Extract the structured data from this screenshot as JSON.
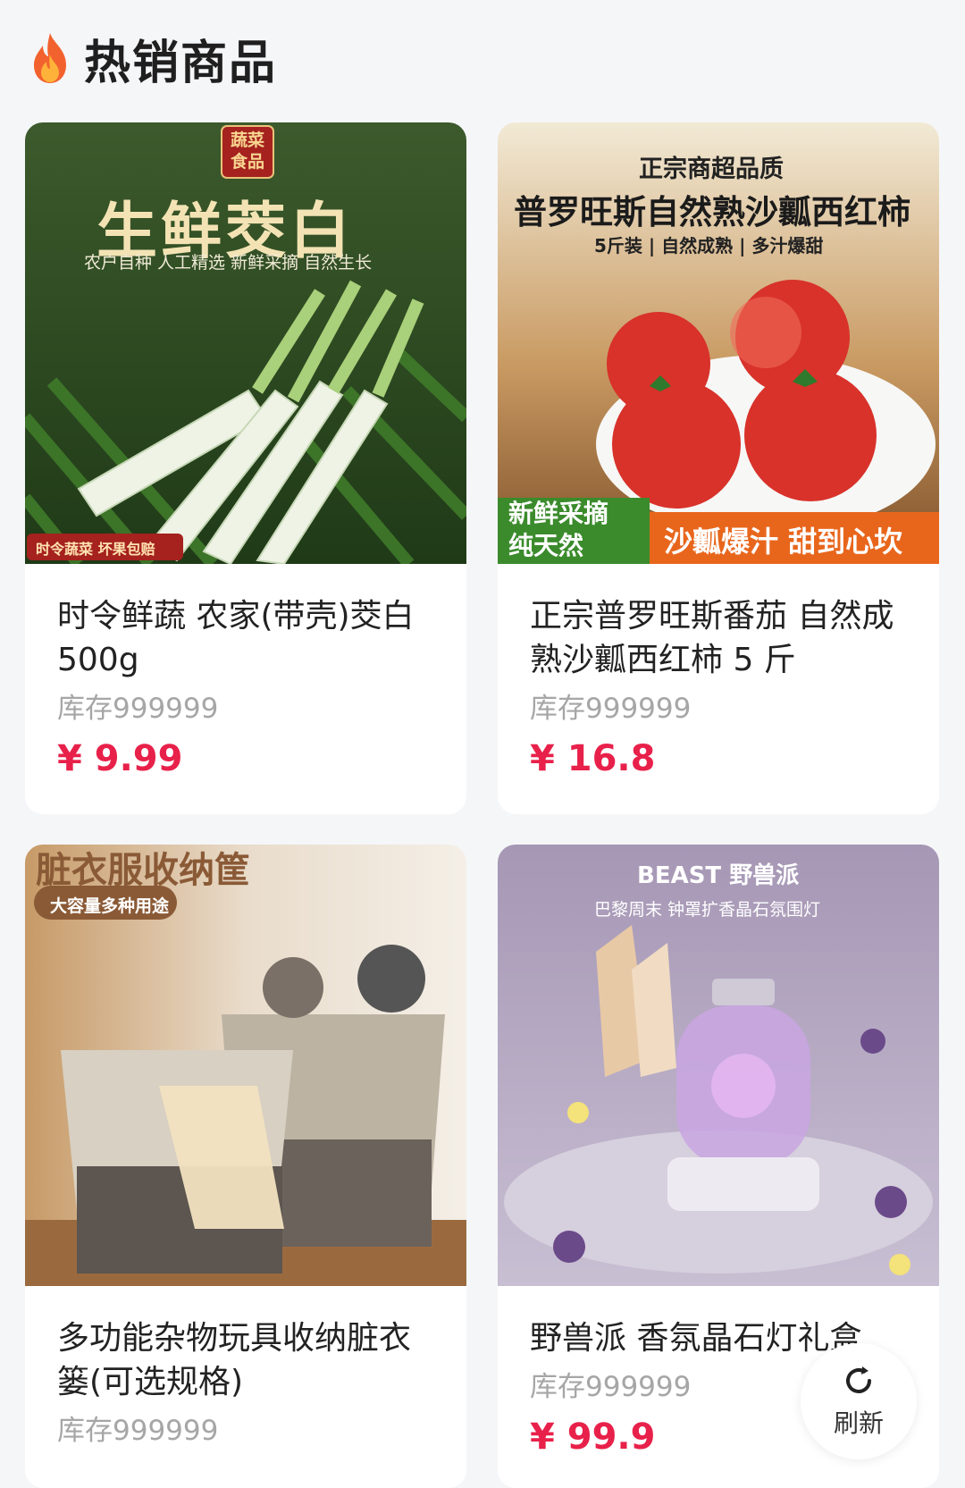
{
  "header": {
    "title": "热销商品",
    "icon": "fire-icon"
  },
  "products": [
    {
      "name": "时令鲜蔬 农家(带壳)茭白500g",
      "stock": "库存999999",
      "price": "¥ 9.99",
      "image": {
        "headline": "生鲜茭白",
        "badge": "蔬菜食品",
        "sub": "农户自种  人工精选  新鲜采摘  自然生长",
        "tag": "时令蔬菜 坏果包赔"
      }
    },
    {
      "name": "正宗普罗旺斯番茄 自然成熟沙瓤西红柿 5 斤",
      "stock": "库存999999",
      "price": "¥ 16.8",
      "image": {
        "top": "正宗商超品质",
        "headline": "普罗旺斯自然熟沙瓤西红柿",
        "sub": "5斤装 | 自然成熟 | 多汁爆甜",
        "left_tag": "新鲜采摘 纯天然",
        "right_tag": "沙瓤爆汁 甜到心坎"
      }
    },
    {
      "name": "多功能杂物玩具收纳脏衣篓(可选规格)",
      "stock": "库存999999",
      "price": "",
      "image": {
        "headline": "脏衣服收纳筐",
        "sub": "大容量多种用途"
      }
    },
    {
      "name": "野兽派 香氛晶石灯礼盒",
      "stock": "库存999999",
      "price": "¥ 99.9",
      "image": {
        "headline": "BEAST 野兽派",
        "sub": "巴黎周末 钟罩扩香晶石氛围灯"
      }
    }
  ],
  "refresh": {
    "label": "刷新",
    "icon": "refresh-icon"
  }
}
